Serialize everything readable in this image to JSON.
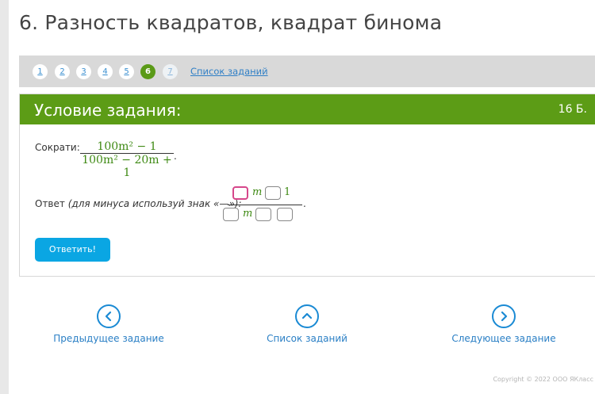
{
  "title": "6. Разность квадратов, квадрат бинома",
  "pager": {
    "pages": [
      "1",
      "2",
      "3",
      "4",
      "5",
      "6",
      "7"
    ],
    "active_index": 5,
    "all_tasks": "Список заданий"
  },
  "task": {
    "header": "Условие задания:",
    "points": "16 Б.",
    "prompt_label": "Сократи:",
    "fraction": {
      "numerator": "100m² − 1",
      "denominator": "100m² − 20m + 1"
    },
    "answer_label": "Ответ",
    "answer_hint": "(для минуса используй знак «—»):",
    "answer_num_m": "m",
    "answer_num_1": "1",
    "answer_den_m": "m",
    "submit": "Ответить!"
  },
  "nav": {
    "prev": "Предыдущее задание",
    "list": "Список заданий",
    "next": "Следующее задание"
  },
  "footer": "Copyright © 2022 ООО ЯКласс",
  "colors": {
    "green": "#5c9c16",
    "blue": "#0aa6e3",
    "link": "#2a7fc5",
    "active_box": "#d6478b"
  }
}
